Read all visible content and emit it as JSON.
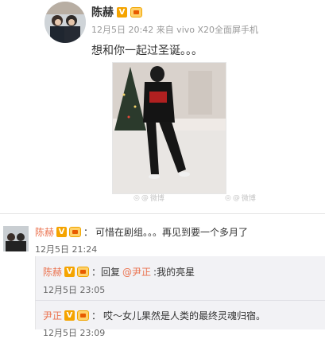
{
  "post": {
    "author": "陈赫",
    "meta": "12月5日 20:42 来自 vivo X20全面屏手机",
    "text": "想和你一起过圣诞。。。",
    "photo_watermark": "微博",
    "image_watermarks": [
      "@",
      "@"
    ]
  },
  "comments": [
    {
      "author": "陈赫",
      "separator": "：",
      "text": "可惜在剧组。。。再见到要一个多月了",
      "time": "12月5日 21:24"
    }
  ],
  "replies": [
    {
      "author": "陈赫",
      "prefix": "：回复",
      "mention": "@尹正",
      "text": ":我的亮星",
      "time": "12月5日 23:05"
    },
    {
      "author": "尹正",
      "separator": "：",
      "text": "哎～女儿果然是人类的最终灵魂归宿。",
      "time": "12月5日 23:09"
    }
  ],
  "colors": {
    "accent": "#eb7350",
    "v_badge": "#f5a400",
    "reply_bg": "#f2f2f5"
  }
}
